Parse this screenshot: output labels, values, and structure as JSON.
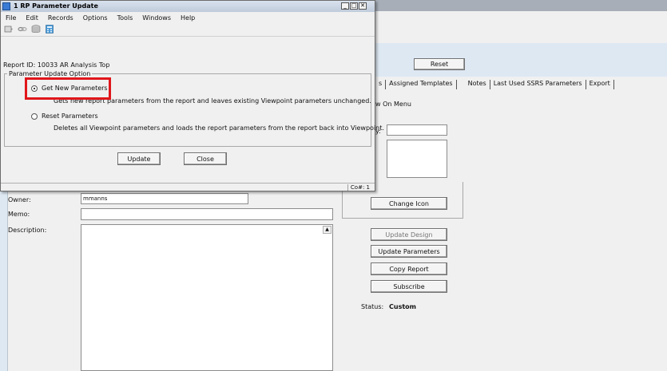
{
  "background": {
    "reset_button": "Reset",
    "tabs": [
      "s",
      "Assigned Templates",
      "Notes",
      "Last Used SSRS Parameters",
      "Export"
    ],
    "show_on_menu": "w On Menu",
    "y_label": "y:",
    "change_icon_button": "Change Icon",
    "owner_label": "Owner:",
    "owner_value": "mmanns",
    "memo_label": "Memo:",
    "description_label": "Description:",
    "buttons": {
      "update_design": "Update Design",
      "update_parameters": "Update Parameters",
      "copy_report": "Copy Report",
      "subscribe": "Subscribe"
    },
    "status_label": "Status:",
    "status_value": "Custom"
  },
  "dialog": {
    "title": "1 RP Parameter Update",
    "menu": [
      "File",
      "Edit",
      "Records",
      "Options",
      "Tools",
      "Windows",
      "Help"
    ],
    "report_id": "Report ID: 10033  AR Analysis Top",
    "group_title": "Parameter Update Option",
    "option1_label": "Get New Parameters",
    "option1_desc": "Gets new report parameters from the report and leaves existing Viewpoint parameters unchanged.",
    "option2_label": "Reset Parameters",
    "option2_desc": "Deletes all Viewpoint parameters and loads the report parameters from the report  back into Viewpoint.",
    "update_button": "Update",
    "close_button": "Close",
    "status_text": "Co#: 1",
    "icons": [
      "tool-icon",
      "link-icon",
      "database-icon",
      "calculator-icon"
    ],
    "selected_option": "Get New Parameters"
  },
  "colors": {
    "highlight": "#e0161b",
    "title_bar": "#bfcbdb",
    "panel": "#dde8f3"
  }
}
